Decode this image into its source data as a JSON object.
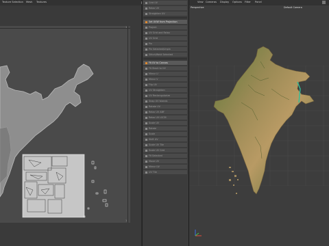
{
  "uv_editor": {
    "menu": [
      "Texture Selection",
      "Mesh",
      "Textures"
    ],
    "tick_top": "1",
    "tick_bottom": "1"
  },
  "tool_list": {
    "items": [
      "Grid UV",
      "Relax UV",
      "Straighten UV",
      "Set UVW from Projection",
      "Project",
      "UV Grid and Relax",
      "UV Grid",
      "Pin",
      "Pin Selected/Unpin",
      "Stitch/Weld Selected",
      "Fit UV to Canvas",
      "Fit Stack to UV",
      "Mirror U",
      "Mirror V",
      "Flip UV",
      "UV Straighten",
      "UV Rectangularize",
      "Snap UV Islands",
      "Rotate UV",
      "Relax UV ABF",
      "Relax UV LSCM",
      "Scale UV",
      "Rotate",
      "Scale",
      "Shift UV",
      "Scale UV Tile",
      "Scale UV Grid",
      "Fit Selected",
      "Move UV",
      "Mirror UV",
      "UV Tile"
    ]
  },
  "viewport": {
    "menu": [
      "View",
      "Cameras",
      "Display",
      "Options",
      "Filter",
      "Panel"
    ],
    "view_name": "Perspective",
    "camera_name": "Default Camera",
    "colors": {
      "land_green": "#5f7a3a",
      "land_tan": "#b89a64",
      "background": "#3d3d3d"
    }
  }
}
